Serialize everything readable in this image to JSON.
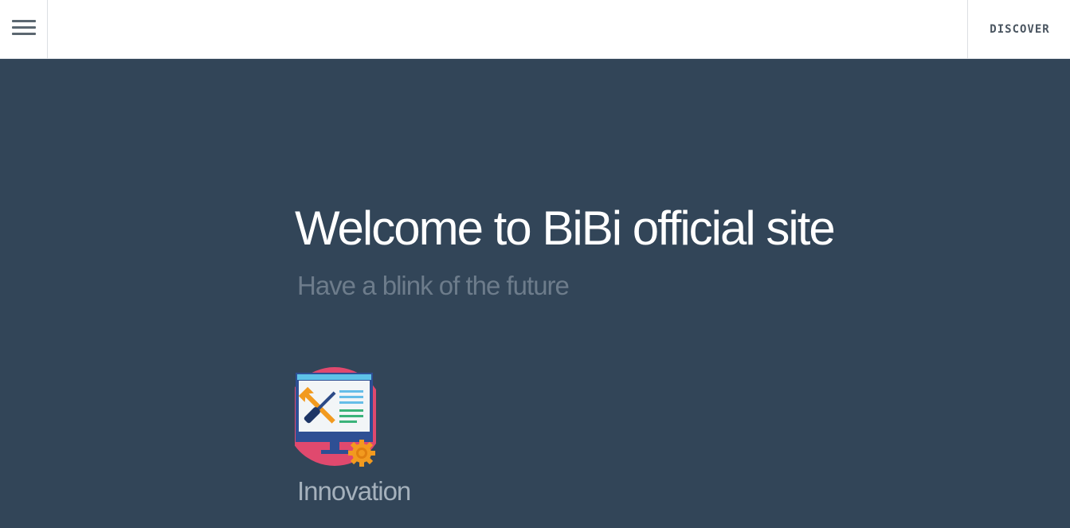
{
  "header": {
    "menu_icon": "hamburger-menu-icon",
    "discover_label": "DISCOVER"
  },
  "hero": {
    "title": "Welcome to BiBi official site",
    "subtitle": "Have a blink of the future",
    "background_color": "#324558"
  },
  "features": [
    {
      "icon": "monitor-tools-gear-icon",
      "label": "Innovation"
    }
  ]
}
